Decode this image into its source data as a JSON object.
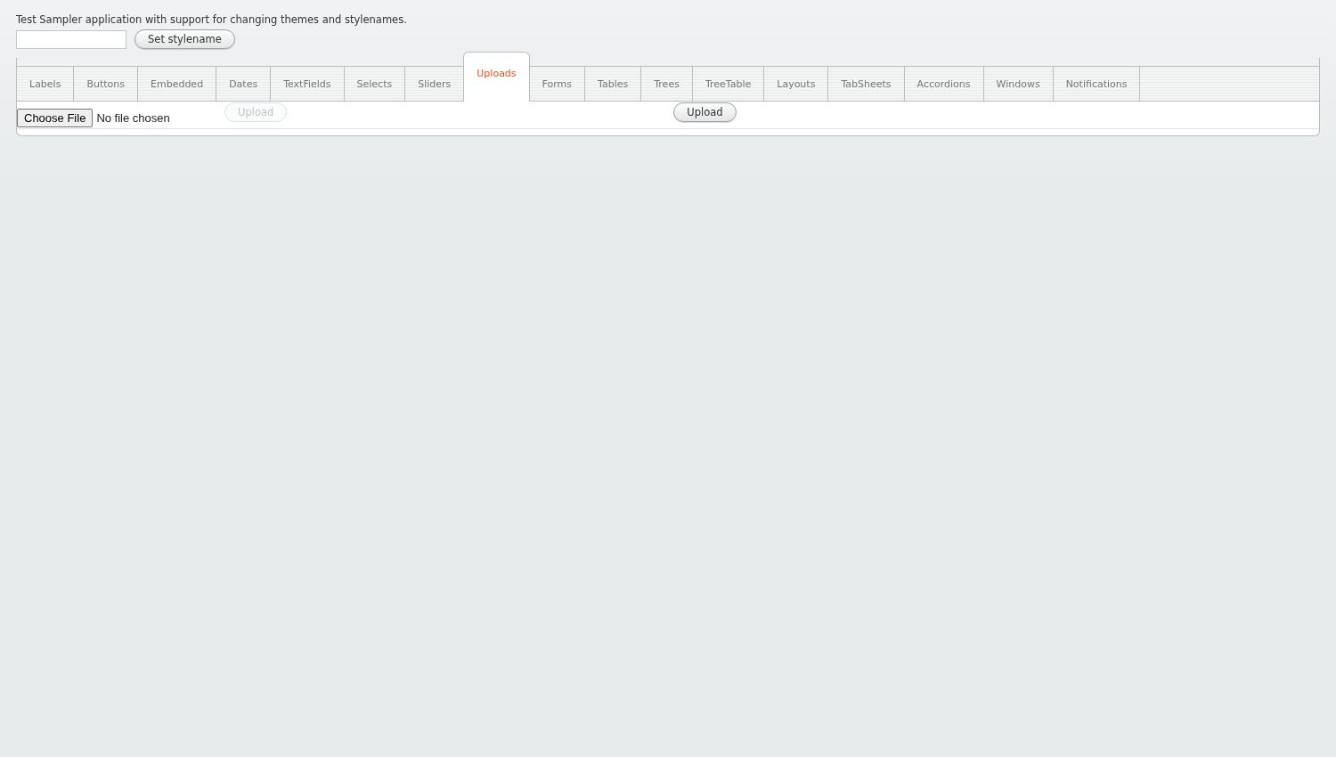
{
  "intro": "Test Sampler application with support for changing themes and stylenames.",
  "stylename": {
    "button": "Set stylename"
  },
  "tabs": [
    {
      "label": "Labels",
      "selected": false
    },
    {
      "label": "Buttons",
      "selected": false
    },
    {
      "label": "Embedded",
      "selected": false
    },
    {
      "label": "Dates",
      "selected": false
    },
    {
      "label": "TextFields",
      "selected": false
    },
    {
      "label": "Selects",
      "selected": false
    },
    {
      "label": "Sliders",
      "selected": false
    },
    {
      "label": "Uploads",
      "selected": true
    },
    {
      "label": "Forms",
      "selected": false
    },
    {
      "label": "Tables",
      "selected": false
    },
    {
      "label": "Trees",
      "selected": false
    },
    {
      "label": "TreeTable",
      "selected": false
    },
    {
      "label": "Layouts",
      "selected": false
    },
    {
      "label": "TabSheets",
      "selected": false
    },
    {
      "label": "Accordions",
      "selected": false
    },
    {
      "label": "Windows",
      "selected": false
    },
    {
      "label": "Notifications",
      "selected": false
    }
  ],
  "upload": {
    "choose_button": "Choose File",
    "file_status": "No file chosen",
    "buttons": [
      {
        "label": "Upload",
        "disabled": true
      },
      {
        "label": "Upload",
        "disabled": false
      }
    ]
  }
}
